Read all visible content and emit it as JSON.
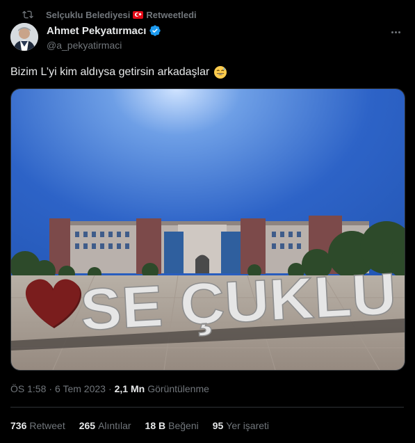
{
  "retweet": {
    "account": "Selçuklu Belediyesi",
    "action": "Retweetledi"
  },
  "author": {
    "name": "Ahmet Pekyatırmacı",
    "handle": "@a_pekyatirmaci"
  },
  "tweet": {
    "text": "Bizim L’yi kim aldıysa getirsin arkadaşlar"
  },
  "media": {
    "sign_text": "SE ÇUKLU"
  },
  "meta": {
    "time": "ÖS 1:58",
    "separator": "·",
    "date": "6 Tem 2023",
    "views_count": "2,1 Mn",
    "views_label": "Görüntülenme"
  },
  "stats": [
    {
      "count": "736",
      "label": "Retweet"
    },
    {
      "count": "265",
      "label": "Alıntılar"
    },
    {
      "count": "18 B",
      "label": "Beğeni"
    },
    {
      "count": "95",
      "label": "Yer işareti"
    }
  ],
  "colors": {
    "background": "#000000",
    "text": "#e7e9ea",
    "muted": "#71767b",
    "verified": "#1d9bf0",
    "divider": "#2f3336"
  },
  "icons": [
    "retweet-icon",
    "turkey-flag-icon",
    "verified-badge-icon",
    "more-options-icon",
    "grinning-sweat-emoji-icon"
  ]
}
